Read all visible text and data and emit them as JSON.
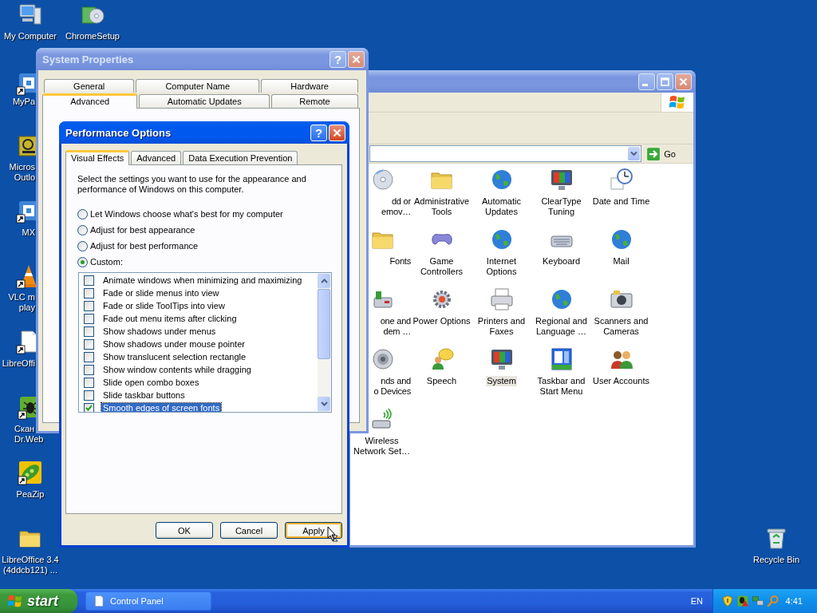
{
  "desktop_icons": [
    {
      "lines": [
        "My Computer"
      ]
    },
    {
      "lines": [
        "ChromeSetup"
      ]
    },
    {
      "lines": [
        "MyPa"
      ]
    },
    {
      "lines": [
        "Micros",
        "Outlo"
      ]
    },
    {
      "lines": [
        "MX"
      ]
    },
    {
      "lines": [
        "VLC m",
        "play"
      ]
    },
    {
      "lines": [
        "LibreOffi"
      ]
    },
    {
      "lines": [
        "Скан",
        "Dr.Web"
      ]
    },
    {
      "lines": [
        "PeaZip"
      ]
    },
    {
      "lines": [
        "LibreOffice 3.4",
        "(4ddcb121) ..."
      ]
    },
    {
      "lines": [
        "Recycle Bin"
      ]
    }
  ],
  "control_panel": {
    "active": false,
    "go_label": "Go",
    "items": [
      {
        "kind": "cut",
        "lines": [
          "dd or",
          "emov…"
        ],
        "selected": false
      },
      {
        "kind": "full",
        "lines": [
          "Administrative",
          "Tools"
        ],
        "selected": false
      },
      {
        "kind": "full",
        "lines": [
          "Automatic",
          "Updates"
        ],
        "selected": false
      },
      {
        "kind": "full",
        "lines": [
          "ClearType",
          "Tuning"
        ],
        "selected": false
      },
      {
        "kind": "full",
        "lines": [
          "Date and Time"
        ],
        "selected": false
      },
      {
        "kind": "cut",
        "lines": [
          "Fonts"
        ],
        "selected": false
      },
      {
        "kind": "full",
        "lines": [
          "Game",
          "Controllers"
        ],
        "selected": false
      },
      {
        "kind": "full",
        "lines": [
          "Internet",
          "Options"
        ],
        "selected": false
      },
      {
        "kind": "full",
        "lines": [
          "Keyboard"
        ],
        "selected": false
      },
      {
        "kind": "full",
        "lines": [
          "Mail"
        ],
        "selected": false
      },
      {
        "kind": "cut",
        "lines": [
          "one and",
          "dem …"
        ],
        "selected": false
      },
      {
        "kind": "full",
        "lines": [
          "Power Options"
        ],
        "selected": false
      },
      {
        "kind": "full",
        "lines": [
          "Printers and",
          "Faxes"
        ],
        "selected": false
      },
      {
        "kind": "full",
        "lines": [
          "Regional and",
          "Language …"
        ],
        "selected": false
      },
      {
        "kind": "full",
        "lines": [
          "Scanners and",
          "Cameras"
        ],
        "selected": false
      },
      {
        "kind": "cut",
        "lines": [
          "nds and",
          "o Devices"
        ],
        "selected": false
      },
      {
        "kind": "full",
        "lines": [
          "Speech"
        ],
        "selected": false
      },
      {
        "kind": "full",
        "lines": [
          "System"
        ],
        "selected": true
      },
      {
        "kind": "full",
        "lines": [
          "Taskbar and",
          "Start Menu"
        ],
        "selected": false
      },
      {
        "kind": "full",
        "lines": [
          "User Accounts"
        ],
        "selected": false
      },
      {
        "kind": "full",
        "lines": [
          "Wireless",
          "Network Set…"
        ],
        "selected": false
      }
    ]
  },
  "system_properties": {
    "title": "System Properties",
    "active": false,
    "help_glyph": "?",
    "tab_rows": [
      [
        {
          "label": "General",
          "selected": false
        },
        {
          "label": "Computer Name",
          "selected": false
        },
        {
          "label": "Hardware",
          "selected": false
        }
      ],
      [
        {
          "label": "Advanced",
          "selected": true
        },
        {
          "label": "Automatic Updates",
          "selected": false
        },
        {
          "label": "Remote",
          "selected": false
        }
      ]
    ]
  },
  "performance_options": {
    "title": "Performance Options",
    "active": true,
    "help_glyph": "?",
    "tabs": [
      {
        "label": "Visual Effects",
        "selected": true
      },
      {
        "label": "Advanced",
        "selected": false
      },
      {
        "label": "Data Execution Prevention",
        "selected": false
      }
    ],
    "description": "Select the settings you want to use for the appearance and performance of Windows on this computer.",
    "options": [
      {
        "label": "Let Windows choose what's best for my computer",
        "selected": false
      },
      {
        "label": "Adjust for best appearance",
        "selected": false
      },
      {
        "label": "Adjust for best performance",
        "selected": false
      },
      {
        "label": "Custom:",
        "selected": true
      }
    ],
    "effects": [
      {
        "label": "Animate windows when minimizing and maximizing",
        "checked": false,
        "selected": false
      },
      {
        "label": "Fade or slide menus into view",
        "checked": false,
        "selected": false
      },
      {
        "label": "Fade or slide ToolTips into view",
        "checked": false,
        "selected": false
      },
      {
        "label": "Fade out menu items after clicking",
        "checked": false,
        "selected": false
      },
      {
        "label": "Show shadows under menus",
        "checked": false,
        "selected": false
      },
      {
        "label": "Show shadows under mouse pointer",
        "checked": false,
        "selected": false
      },
      {
        "label": "Show translucent selection rectangle",
        "checked": false,
        "selected": false
      },
      {
        "label": "Show window contents while dragging",
        "checked": false,
        "selected": false
      },
      {
        "label": "Slide open combo boxes",
        "checked": false,
        "selected": false
      },
      {
        "label": "Slide taskbar buttons",
        "checked": false,
        "selected": false
      },
      {
        "label": "Smooth edges of screen fonts",
        "checked": true,
        "selected": true
      }
    ],
    "buttons": [
      {
        "label": "OK",
        "hovered": false
      },
      {
        "label": "Cancel",
        "hovered": false
      },
      {
        "label": "Apply",
        "hovered": true
      }
    ]
  },
  "taskbar": {
    "start_label": "start",
    "tasks": [
      {
        "label": "Control Panel",
        "selected": false
      }
    ],
    "language": "EN",
    "clock": "4:41"
  }
}
